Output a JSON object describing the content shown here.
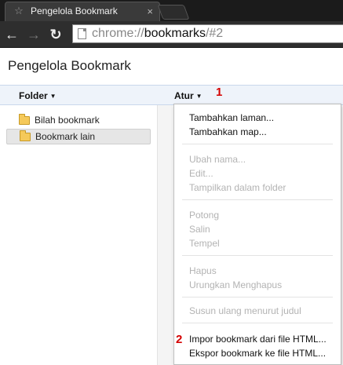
{
  "window": {
    "tab_title": "Pengelola Bookmark",
    "tab_favicon": "star-icon",
    "tab_close": "×"
  },
  "toolbar": {
    "back_glyph": "←",
    "forward_glyph": "→",
    "reload_glyph": "↻",
    "url_scheme": "chrome://",
    "url_host": "bookmarks",
    "url_path": "/#2"
  },
  "page": {
    "title": "Pengelola Bookmark"
  },
  "columns": {
    "folder": "Folder",
    "organize": "Atur"
  },
  "annotations": {
    "marker_1": "1",
    "marker_2": "2"
  },
  "tree": {
    "items": [
      {
        "label": "Bilah bookmark",
        "selected": false
      },
      {
        "label": "Bookmark lain",
        "selected": true
      }
    ]
  },
  "menu": {
    "add_page": "Tambahkan laman...",
    "add_folder": "Tambahkan map...",
    "rename": "Ubah nama...",
    "edit": "Edit...",
    "show_in_folder": "Tampilkan dalam folder",
    "cut": "Potong",
    "copy": "Salin",
    "paste": "Tempel",
    "delete": "Hapus",
    "undo_delete": "Urungkan Menghapus",
    "sort_by_title": "Susun ulang menurut judul",
    "import_html": "Impor bookmark dari file HTML...",
    "export_html": "Ekspor bookmark ke file HTML..."
  }
}
